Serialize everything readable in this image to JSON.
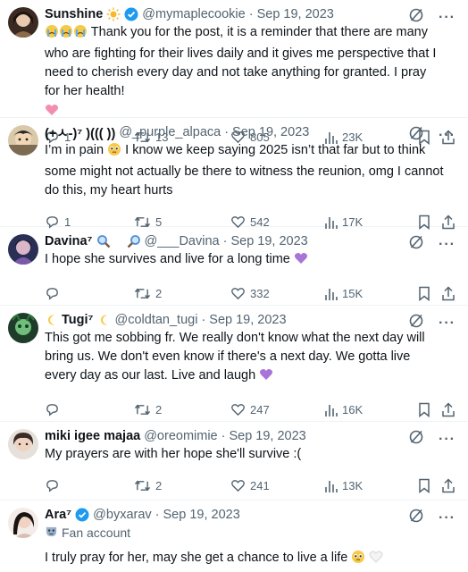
{
  "tweets": [
    {
      "name": "Sunshine",
      "handle": "@mymaplecookie",
      "date": "Sep 19, 2023",
      "text": "Thank you for the post, it is a reminder that there are many who are fighting for their lives daily and it gives me perspective that I need to cherish every day and not take anything for granted. I pray for her health!",
      "replies": "1",
      "retweets": "13",
      "likes": "805",
      "views": "23K"
    },
    {
      "name": "(+ㅅ-)⁷ )((( ))",
      "handle": "@_purple_alpaca",
      "date": "Sep 19, 2023",
      "text": "I’m in pain  I know we keep saying 2025 isn’t that far but to think some might not actually be there to witness the reunion, omg I cannot do this, my heart hurts",
      "text_prefix": "I’m in pain",
      "text_rest": "I know we keep saying 2025 isn’t that far but to think some might not actually be there to witness the reunion, omg I cannot do this, my heart hurts",
      "replies": "1",
      "retweets": "5",
      "likes": "542",
      "views": "17K"
    },
    {
      "name": "Davina⁷",
      "handle": "@___Davina",
      "date": "Sep 19, 2023",
      "text": "I hope she survives and live for a long time",
      "replies": "",
      "retweets": "2",
      "likes": "332",
      "views": "15K"
    },
    {
      "name": "Tugi⁷",
      "handle": "@coldtan_tugi",
      "date": "Sep 19, 2023",
      "text": "This got me sobbing fr. We really don't know what the next day will bring us. We don't even know if there's a next day. We gotta live every day as our last. Live and laugh",
      "replies": "",
      "retweets": "2",
      "likes": "247",
      "views": "16K"
    },
    {
      "name": "miki igee majaa",
      "handle": "@oreomimie",
      "date": "Sep 19, 2023",
      "text": "My prayers are with her hope she'll survive :(",
      "replies": "",
      "retweets": "2",
      "likes": "241",
      "views": "13K"
    },
    {
      "name": "Ara⁷",
      "handle": "@byxarav",
      "date": "Sep 19, 2023",
      "label": "Fan account",
      "text": "I truly pray for her, may she get a chance to live a life"
    }
  ],
  "separator": "·",
  "icons": {
    "grok": "slashed-circle-icon",
    "more": "more-icon",
    "reply": "reply-icon",
    "retweet": "retweet-icon",
    "like": "heart-icon",
    "views": "views-icon",
    "bookmark": "bookmark-icon",
    "share": "share-icon"
  },
  "colors": {
    "verified": "#1d9bf0",
    "muted": "#536471",
    "text": "#0f1419",
    "purple_heart": "#a974d8"
  }
}
